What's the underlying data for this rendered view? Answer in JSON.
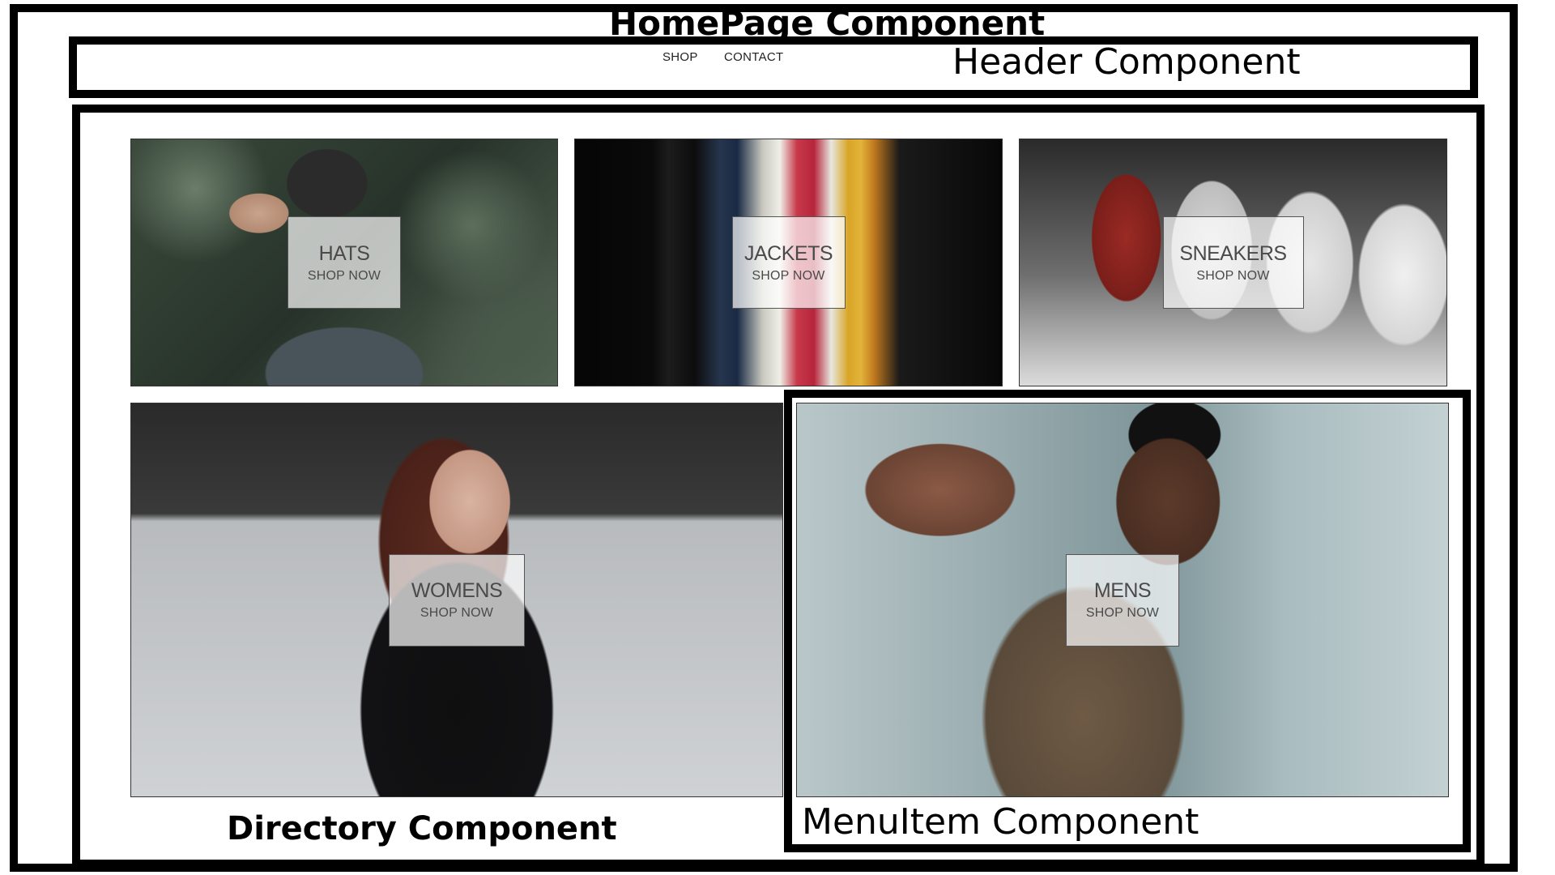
{
  "annotations": {
    "homepage": "HomePage Component",
    "header": "Header Component",
    "directory": "Directory Component",
    "menuitem": "MenuItem Component"
  },
  "header": {
    "nav": [
      {
        "label": "SHOP"
      },
      {
        "label": "CONTACT"
      }
    ]
  },
  "directory": {
    "items": [
      {
        "title": "HATS",
        "subtitle": "SHOP NOW"
      },
      {
        "title": "JACKETS",
        "subtitle": "SHOP NOW"
      },
      {
        "title": "SNEAKERS",
        "subtitle": "SHOP NOW"
      },
      {
        "title": "WOMENS",
        "subtitle": "SHOP NOW"
      },
      {
        "title": "MENS",
        "subtitle": "SHOP NOW"
      }
    ]
  }
}
